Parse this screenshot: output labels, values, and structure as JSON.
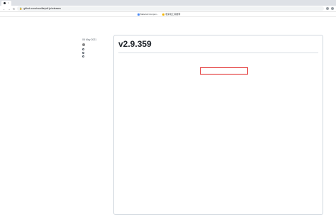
{
  "browser": {
    "url": "github.com/mozilla/pdf.js/releases",
    "tabs": [],
    "bookmarks": [
      "Material Compon...",
      "框架和工具推荐"
    ]
  },
  "sidebar": {
    "date": "05 May 2021",
    "author": "",
    "meta": []
  },
  "release": {
    "title": "v2.9.359",
    "intro": "",
    "installed_section": "",
    "entries": []
  }
}
